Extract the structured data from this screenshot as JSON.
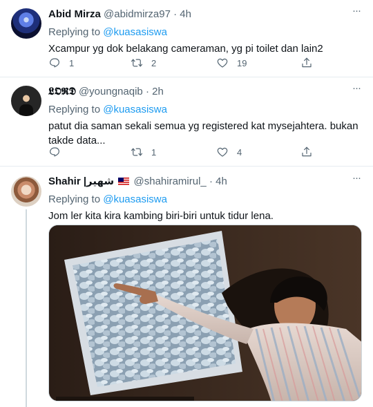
{
  "tweets": [
    {
      "name": "Abid Mirza",
      "handle": "@abidmirza97",
      "time": "4h",
      "replying_prefix": "Replying to",
      "replying_to": "@kuasasiswa",
      "text": "Xcampur yg dok belakang cameraman, yg pi toilet dan lain2",
      "replies": "1",
      "retweets": "2",
      "likes": "19"
    },
    {
      "name": "𝕷𝕺𝕽𝕯",
      "handle": "@youngnaqib",
      "time": "2h",
      "replying_prefix": "Replying to",
      "replying_to": "@kuasasiswa",
      "text": "patut dia saman sekali semua yg registered kat mysejahtera. bukan takde data...",
      "replies": "",
      "retweets": "1",
      "likes": "4"
    },
    {
      "name": "Shahir |شهير",
      "handle": "@shahiramirul_",
      "time": "4h",
      "replying_prefix": "Replying to",
      "replying_to": "@kuasasiswa",
      "text": "Jom ler kita kira kambing biri-biri untuk tidur lena."
    }
  ],
  "separator": "·",
  "more_label": "···",
  "colors": {
    "accent": "#1d9bf0",
    "muted": "#536471",
    "divider": "#e6ecf0"
  },
  "icons": [
    "reply-icon",
    "retweet-icon",
    "like-icon",
    "share-icon",
    "more-icon",
    "malaysia-flag-icon"
  ]
}
